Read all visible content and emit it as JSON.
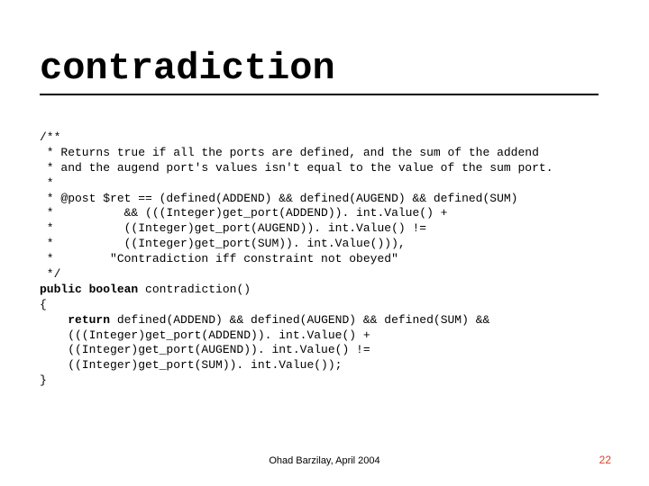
{
  "slide": {
    "title": "contradiction",
    "code": {
      "l01": "/**",
      "l02": " * Returns true if all the ports are defined, and the sum of the addend",
      "l03": " * and the augend port's values isn't equal to the value of the sum port.",
      "l04": " *",
      "l05": " * @post $ret == (defined(ADDEND) && defined(AUGEND) && defined(SUM)",
      "l06": " *          && (((Integer)get_port(ADDEND)). int.Value() +",
      "l07": " *          ((Integer)get_port(AUGEND)). int.Value() !=",
      "l08": " *          ((Integer)get_port(SUM)). int.Value())),",
      "l09": " *        \"Contradiction iff constraint not obeyed\"",
      "l10": " */",
      "kw_public": "public",
      "kw_boolean": "boolean",
      "fn_sig": " contradiction()",
      "l12": "{",
      "indent": "    ",
      "kw_return": "return",
      "ret_tail": " defined(ADDEND) && defined(AUGEND) && defined(SUM) &&",
      "l14": "    (((Integer)get_port(ADDEND)). int.Value() +",
      "l15": "    ((Integer)get_port(AUGEND)). int.Value() !=",
      "l16": "    ((Integer)get_port(SUM)). int.Value());",
      "l17": "}"
    },
    "footer": "Ohad Barzilay, April 2004",
    "page_number": "22"
  }
}
